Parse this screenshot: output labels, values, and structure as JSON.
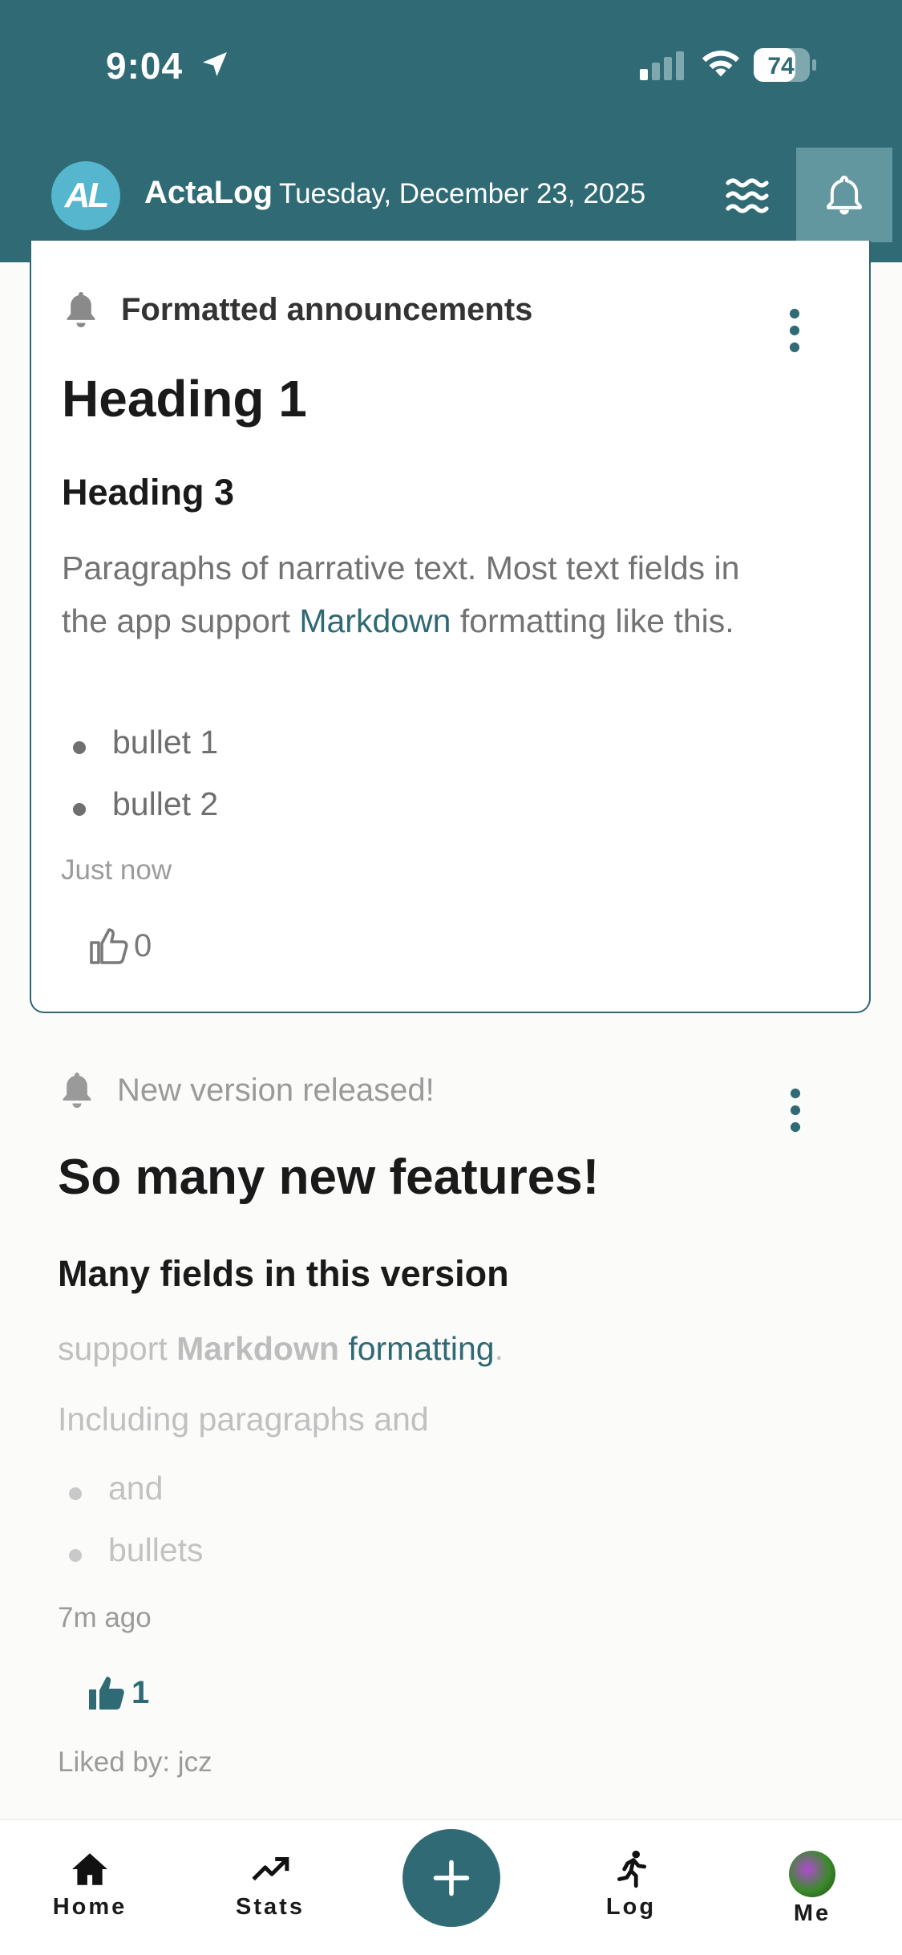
{
  "status_bar": {
    "time": "9:04",
    "battery": "74"
  },
  "header": {
    "logo_text": "AL",
    "app_name": "ActaLog",
    "date": "Tuesday, December 23, 2025"
  },
  "announcements": [
    {
      "title": "Formatted announcements",
      "heading1": "Heading 1",
      "heading3": "Heading 3",
      "paragraph_pre": "Paragraphs of narrative text. Most text fields in the app support ",
      "paragraph_link": "Markdown",
      "paragraph_post": " formatting like this.",
      "bullets": [
        "bullet 1",
        "bullet 2"
      ],
      "timestamp": "Just now",
      "likes": "0"
    },
    {
      "title": "New version released!",
      "heading1": "So many new features!",
      "heading3": "Many fields in this version",
      "line1_pre": "support ",
      "line1_bold": "Markdown",
      "line1_link": "formatting",
      "line1_post": ".",
      "line2": "Including paragraphs and",
      "bullets": [
        "and",
        "bullets"
      ],
      "timestamp": "7m ago",
      "likes": "1",
      "liked_by": "Liked by: jcz"
    }
  ],
  "nav": {
    "home": "Home",
    "stats": "Stats",
    "log": "Log",
    "me": "Me"
  },
  "colors": {
    "primary": "#306b75",
    "logo": "#55b6cd",
    "link": "#2f6a74"
  }
}
